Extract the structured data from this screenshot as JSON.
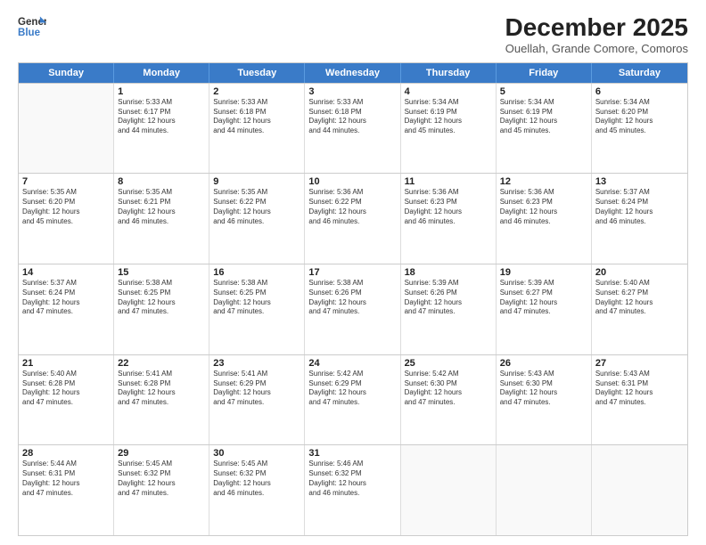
{
  "header": {
    "logo_line1": "General",
    "logo_line2": "Blue",
    "month": "December 2025",
    "location": "Ouellah, Grande Comore, Comoros"
  },
  "days_of_week": [
    "Sunday",
    "Monday",
    "Tuesday",
    "Wednesday",
    "Thursday",
    "Friday",
    "Saturday"
  ],
  "weeks": [
    [
      {
        "day": "",
        "info": ""
      },
      {
        "day": "1",
        "info": "Sunrise: 5:33 AM\nSunset: 6:17 PM\nDaylight: 12 hours\nand 44 minutes."
      },
      {
        "day": "2",
        "info": "Sunrise: 5:33 AM\nSunset: 6:18 PM\nDaylight: 12 hours\nand 44 minutes."
      },
      {
        "day": "3",
        "info": "Sunrise: 5:33 AM\nSunset: 6:18 PM\nDaylight: 12 hours\nand 44 minutes."
      },
      {
        "day": "4",
        "info": "Sunrise: 5:34 AM\nSunset: 6:19 PM\nDaylight: 12 hours\nand 45 minutes."
      },
      {
        "day": "5",
        "info": "Sunrise: 5:34 AM\nSunset: 6:19 PM\nDaylight: 12 hours\nand 45 minutes."
      },
      {
        "day": "6",
        "info": "Sunrise: 5:34 AM\nSunset: 6:20 PM\nDaylight: 12 hours\nand 45 minutes."
      }
    ],
    [
      {
        "day": "7",
        "info": "Sunrise: 5:35 AM\nSunset: 6:20 PM\nDaylight: 12 hours\nand 45 minutes."
      },
      {
        "day": "8",
        "info": "Sunrise: 5:35 AM\nSunset: 6:21 PM\nDaylight: 12 hours\nand 46 minutes."
      },
      {
        "day": "9",
        "info": "Sunrise: 5:35 AM\nSunset: 6:22 PM\nDaylight: 12 hours\nand 46 minutes."
      },
      {
        "day": "10",
        "info": "Sunrise: 5:36 AM\nSunset: 6:22 PM\nDaylight: 12 hours\nand 46 minutes."
      },
      {
        "day": "11",
        "info": "Sunrise: 5:36 AM\nSunset: 6:23 PM\nDaylight: 12 hours\nand 46 minutes."
      },
      {
        "day": "12",
        "info": "Sunrise: 5:36 AM\nSunset: 6:23 PM\nDaylight: 12 hours\nand 46 minutes."
      },
      {
        "day": "13",
        "info": "Sunrise: 5:37 AM\nSunset: 6:24 PM\nDaylight: 12 hours\nand 46 minutes."
      }
    ],
    [
      {
        "day": "14",
        "info": "Sunrise: 5:37 AM\nSunset: 6:24 PM\nDaylight: 12 hours\nand 47 minutes."
      },
      {
        "day": "15",
        "info": "Sunrise: 5:38 AM\nSunset: 6:25 PM\nDaylight: 12 hours\nand 47 minutes."
      },
      {
        "day": "16",
        "info": "Sunrise: 5:38 AM\nSunset: 6:25 PM\nDaylight: 12 hours\nand 47 minutes."
      },
      {
        "day": "17",
        "info": "Sunrise: 5:38 AM\nSunset: 6:26 PM\nDaylight: 12 hours\nand 47 minutes."
      },
      {
        "day": "18",
        "info": "Sunrise: 5:39 AM\nSunset: 6:26 PM\nDaylight: 12 hours\nand 47 minutes."
      },
      {
        "day": "19",
        "info": "Sunrise: 5:39 AM\nSunset: 6:27 PM\nDaylight: 12 hours\nand 47 minutes."
      },
      {
        "day": "20",
        "info": "Sunrise: 5:40 AM\nSunset: 6:27 PM\nDaylight: 12 hours\nand 47 minutes."
      }
    ],
    [
      {
        "day": "21",
        "info": "Sunrise: 5:40 AM\nSunset: 6:28 PM\nDaylight: 12 hours\nand 47 minutes."
      },
      {
        "day": "22",
        "info": "Sunrise: 5:41 AM\nSunset: 6:28 PM\nDaylight: 12 hours\nand 47 minutes."
      },
      {
        "day": "23",
        "info": "Sunrise: 5:41 AM\nSunset: 6:29 PM\nDaylight: 12 hours\nand 47 minutes."
      },
      {
        "day": "24",
        "info": "Sunrise: 5:42 AM\nSunset: 6:29 PM\nDaylight: 12 hours\nand 47 minutes."
      },
      {
        "day": "25",
        "info": "Sunrise: 5:42 AM\nSunset: 6:30 PM\nDaylight: 12 hours\nand 47 minutes."
      },
      {
        "day": "26",
        "info": "Sunrise: 5:43 AM\nSunset: 6:30 PM\nDaylight: 12 hours\nand 47 minutes."
      },
      {
        "day": "27",
        "info": "Sunrise: 5:43 AM\nSunset: 6:31 PM\nDaylight: 12 hours\nand 47 minutes."
      }
    ],
    [
      {
        "day": "28",
        "info": "Sunrise: 5:44 AM\nSunset: 6:31 PM\nDaylight: 12 hours\nand 47 minutes."
      },
      {
        "day": "29",
        "info": "Sunrise: 5:45 AM\nSunset: 6:32 PM\nDaylight: 12 hours\nand 47 minutes."
      },
      {
        "day": "30",
        "info": "Sunrise: 5:45 AM\nSunset: 6:32 PM\nDaylight: 12 hours\nand 46 minutes."
      },
      {
        "day": "31",
        "info": "Sunrise: 5:46 AM\nSunset: 6:32 PM\nDaylight: 12 hours\nand 46 minutes."
      },
      {
        "day": "",
        "info": ""
      },
      {
        "day": "",
        "info": ""
      },
      {
        "day": "",
        "info": ""
      }
    ]
  ]
}
